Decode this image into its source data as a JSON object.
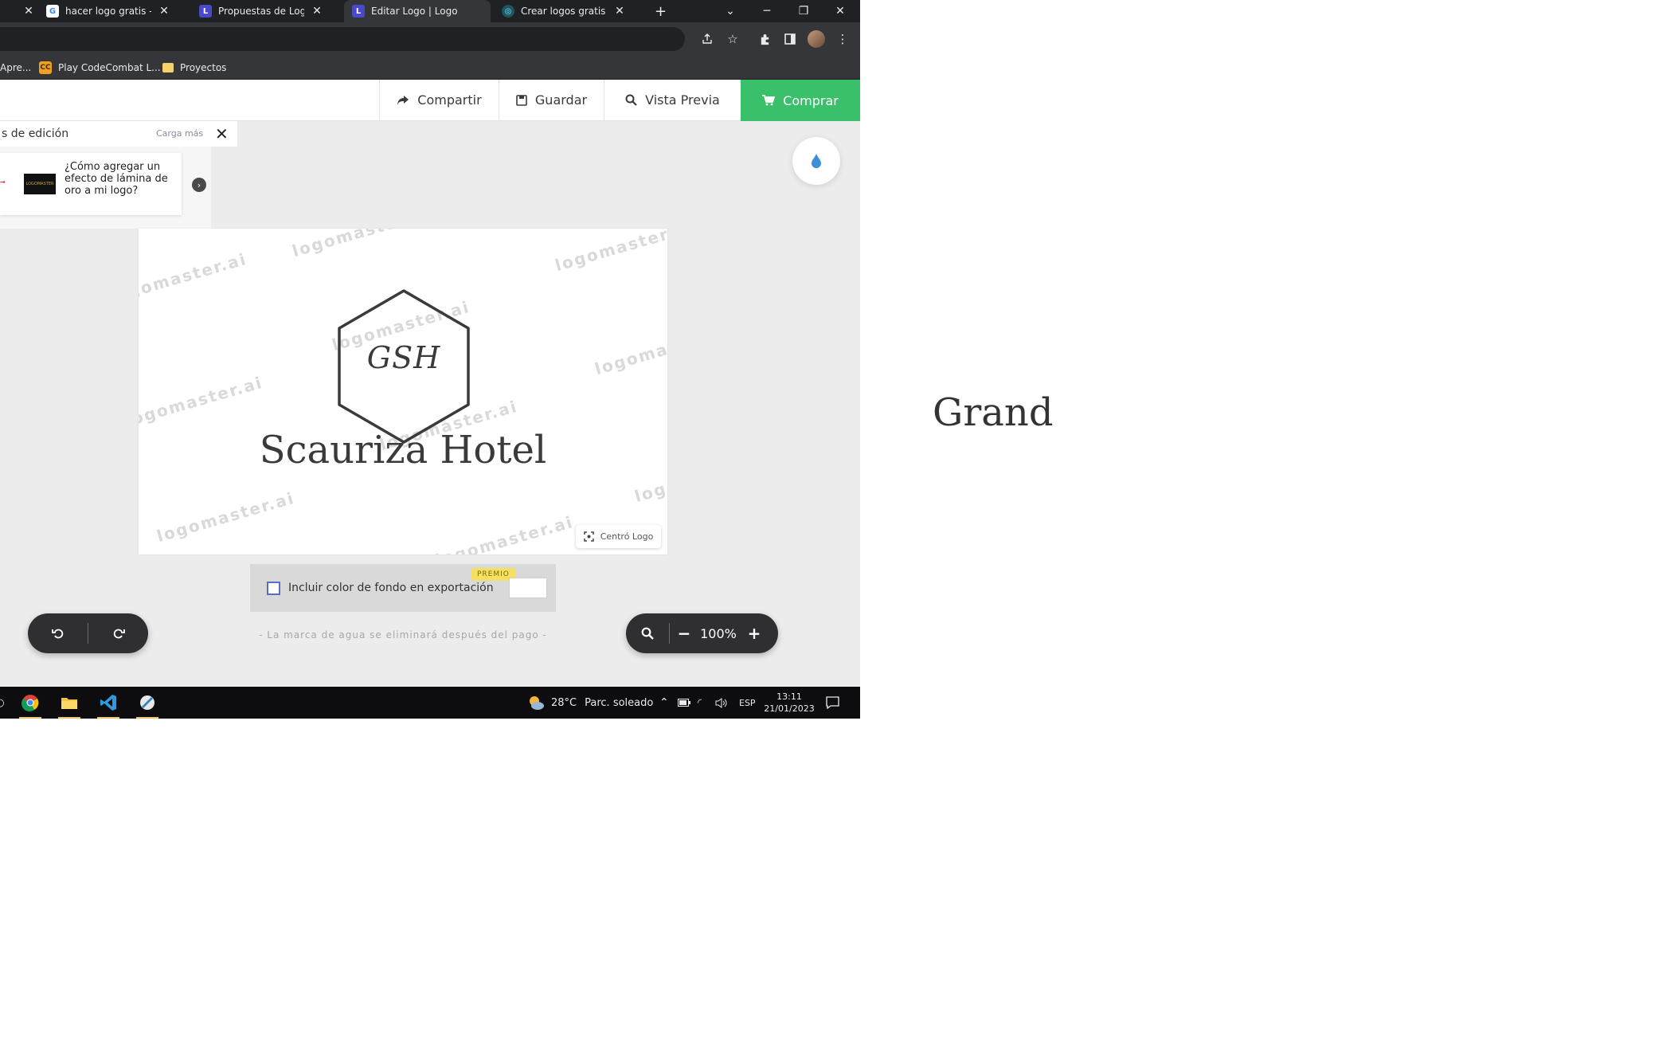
{
  "browser": {
    "tabs": [
      {
        "title": "hacer logo gratis - Busc",
        "favicon": "google-g-icon",
        "favicon_color": "#4285f4"
      },
      {
        "title": "Propuestas de Logo | Lo",
        "favicon": "L",
        "favicon_color": "#4a4ac8"
      },
      {
        "title": "Editar Logo | Logomaste",
        "favicon": "L",
        "favicon_color": "#4a4ac8"
      },
      {
        "title": "Crear logos gratis en mi",
        "favicon": "logo-icon",
        "favicon_color": "#33aacc"
      }
    ],
    "bookmarks": [
      {
        "label": "Apre..."
      },
      {
        "label": "Play CodeCombat L...",
        "icon": "CC"
      },
      {
        "label": "Proyectos",
        "icon": "folder-icon"
      }
    ]
  },
  "header": {
    "share": "Compartir",
    "save": "Guardar",
    "preview": "Vista Previa",
    "buy": "Comprar",
    "buy_color": "#3ac06a"
  },
  "tips": {
    "title": "s de edición",
    "load_more": "Carga más",
    "card_text": "¿Cómo agregar un efecto de lámina de oro a mi logo?",
    "card_thumb_text": "LOGOMASTER"
  },
  "canvas": {
    "monogram": "GSH",
    "brand_name": "Scauriza Hotel",
    "center_label": "Centró Logo",
    "watermark": "logomaster.ai"
  },
  "export": {
    "label": "Incluir color de fondo en exportación",
    "badge": "PREMIO",
    "note": "- La marca de agua se eliminará después del pago -"
  },
  "zoom": {
    "level": "100%"
  },
  "taskbar": {
    "weather": "28°C",
    "weather_desc": "Parc. soleado",
    "lang": "ESP",
    "time": "13:11",
    "date": "21/01/2023"
  },
  "side_text": "Grand"
}
